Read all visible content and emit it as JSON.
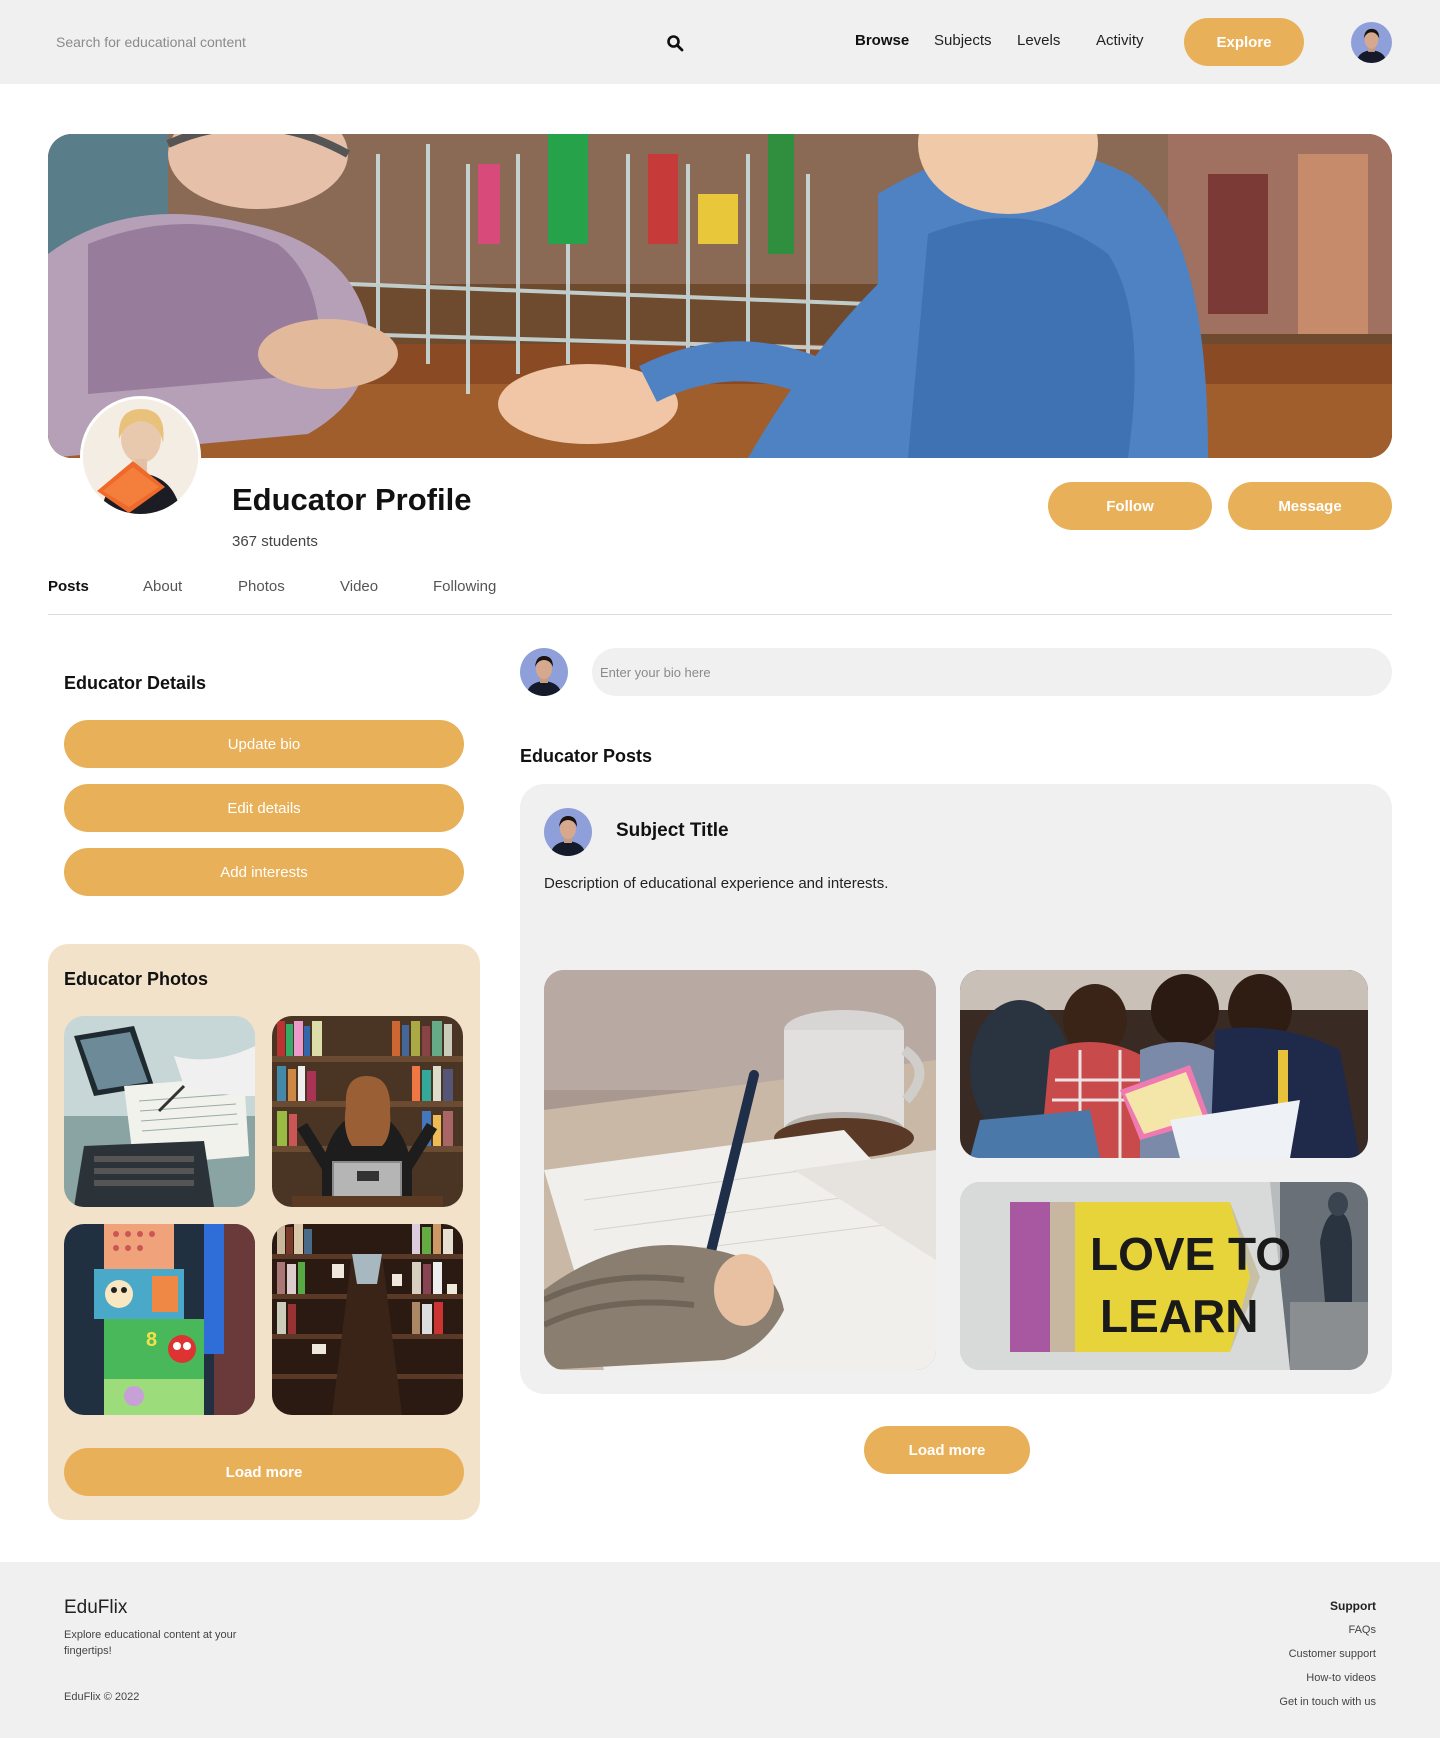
{
  "header": {
    "search_placeholder": "Search for educational content",
    "nav": [
      "Browse",
      "Subjects",
      "Levels",
      "Activity"
    ],
    "explore_label": "Explore"
  },
  "profile": {
    "title": "Educator Profile",
    "students": "367 students",
    "follow_label": "Follow",
    "message_label": "Message"
  },
  "tabs": [
    "Posts",
    "About",
    "Photos",
    "Video",
    "Following"
  ],
  "details": {
    "title": "Educator Details",
    "buttons": [
      "Update bio",
      "Edit details",
      "Add interests"
    ]
  },
  "photos": {
    "title": "Educator Photos",
    "load_more": "Load more"
  },
  "bio": {
    "placeholder": "Enter your bio here"
  },
  "posts": {
    "title": "Educator Posts",
    "post_title": "Subject Title",
    "post_desc": "Description of educational experience and interests.",
    "sign_text": [
      "LOVE TO",
      "LEARN"
    ],
    "load_more": "Load more"
  },
  "footer": {
    "brand": "EduFlix",
    "tagline": "Explore educational content at your fingertips!",
    "copyright": "EduFlix © 2022",
    "links_title": "Support",
    "links": [
      "FAQs",
      "Customer support",
      "How-to videos",
      "Get in touch with us"
    ]
  },
  "colors": {
    "accent": "#e9b05a",
    "panel": "#f2e2ca",
    "surface": "#f0f0f0"
  }
}
